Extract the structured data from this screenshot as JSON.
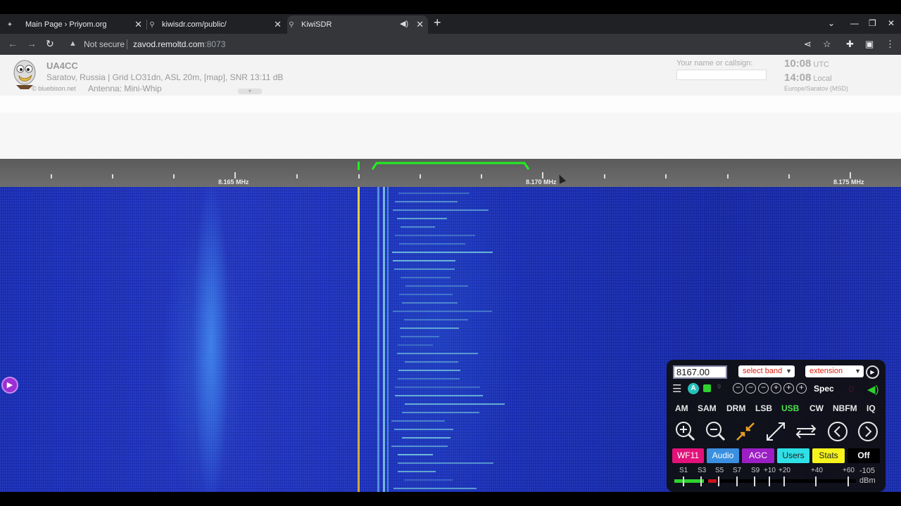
{
  "browser": {
    "tabs": [
      {
        "title": "Main Page › Priyom.org",
        "icon": "priyom-favicon"
      },
      {
        "title": "kiwisdr.com/public/",
        "icon": "kiwisdr-favicon"
      },
      {
        "title": "KiwiSDR",
        "icon": "kiwisdr-favicon",
        "audio_icon": "speaker-icon"
      }
    ],
    "security_text": "Not secure",
    "url_host": "zavod.remoltd.com",
    "url_port": ":8073"
  },
  "receiver": {
    "name": "UA4CC",
    "location": "Saratov, Russia | Grid LO31dn, ASL 20m, [map], SNR 13:11 dB",
    "credit": "© bluebison.net",
    "antenna": "Antenna: Mini-Whip",
    "callsign_label": "Your name or callsign:",
    "callsign_value": "",
    "utc_time": "10:08",
    "utc_label": "UTC",
    "local_time": "14:08",
    "local_label": "Local",
    "timezone": "Europe/Saratov (MSD)"
  },
  "scale": {
    "labels": [
      "8.165 MHz",
      "8.170 MHz",
      "8.175 MHz"
    ],
    "passband_color": "#22ee22"
  },
  "controls": {
    "frequency": "8167.00",
    "band_select": "select band",
    "extension_select": "extension",
    "auto_label": "A",
    "spec_label": "Spec",
    "modes": [
      "AM",
      "SAM",
      "DRM",
      "LSB",
      "USB",
      "CW",
      "NBFM",
      "IQ"
    ],
    "active_mode": "USB",
    "tabs": [
      {
        "label": "WF11",
        "color": "#e2127a"
      },
      {
        "label": "Audio",
        "color": "#3a8fe0"
      },
      {
        "label": "AGC",
        "color": "#9c1fc4"
      },
      {
        "label": "Users",
        "color": "#2fe0e6"
      },
      {
        "label": "Stats",
        "color": "#f5f21d"
      },
      {
        "label": "Off",
        "color": "#000000"
      }
    ],
    "smeter_labels": [
      "S1",
      "S3",
      "S5",
      "S7",
      "S9",
      "+10",
      "+20",
      "+40",
      "+60"
    ],
    "smeter_level": "-105",
    "smeter_unit": "dBm"
  }
}
